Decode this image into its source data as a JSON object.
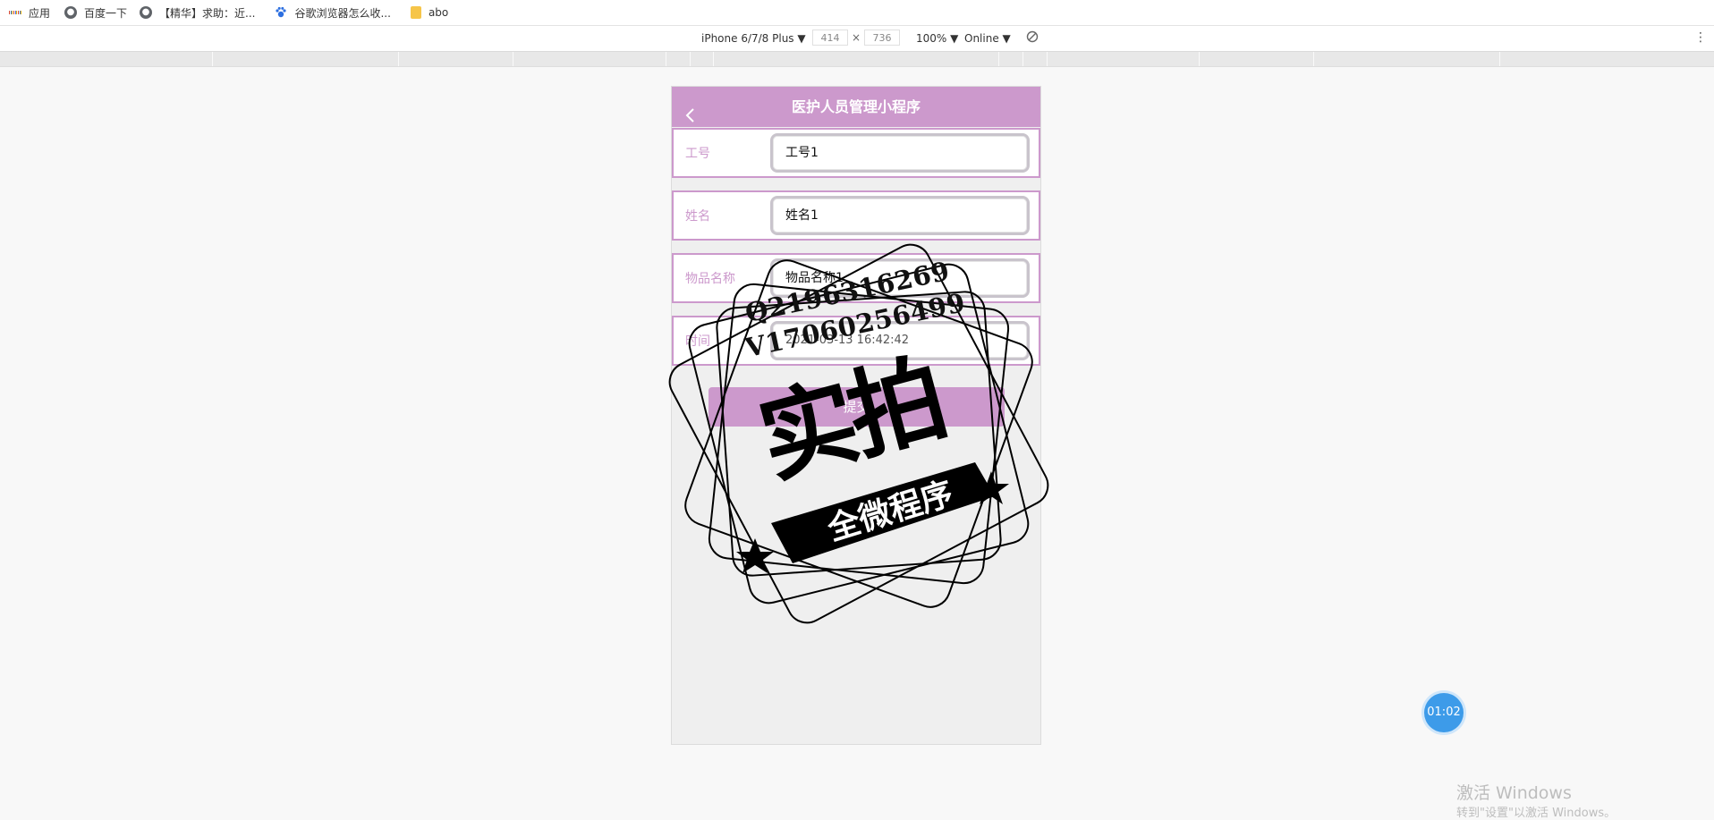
{
  "bookmarks": {
    "apps": "应用",
    "items": [
      "百度一下",
      "【精华】求助：近...",
      "谷歌浏览器怎么收...",
      "abo"
    ]
  },
  "devtools": {
    "device": "iPhone 6/7/8 Plus ▼",
    "width": "414",
    "times": "×",
    "height": "736",
    "zoom": "100% ▼",
    "network": "Online ▼",
    "more": "⋮"
  },
  "app": {
    "title": "医护人员管理小程序",
    "fields": [
      {
        "label": "工号",
        "value": "工号1"
      },
      {
        "label": "姓名",
        "value": "姓名1"
      },
      {
        "label": "物品名称",
        "value": "物品名称1"
      },
      {
        "label": "时间",
        "value": "2021-03-13 16:42:42"
      }
    ],
    "submit": "提交"
  },
  "watermark": {
    "q": "Q2196316269",
    "v": "V17060256499",
    "big": "实拍",
    "band": "全微程序"
  },
  "timer": "01:02",
  "windows": {
    "title": "激活 Windows",
    "sub": "转到\"设置\"以激活 Windows。"
  },
  "colors": {
    "accent": "#cc99cc",
    "timer": "#3d9be9"
  }
}
